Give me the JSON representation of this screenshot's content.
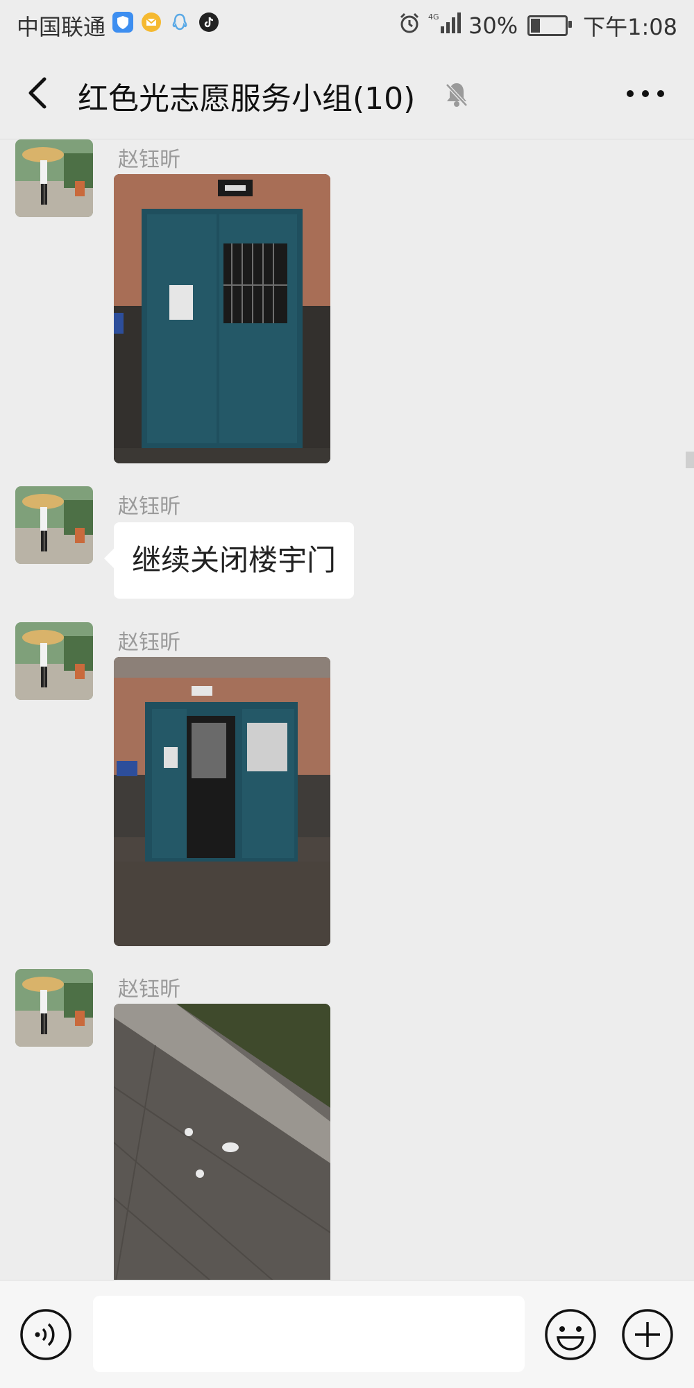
{
  "status_bar": {
    "carrier": "中国联通",
    "battery": "30%",
    "battery_level": 0.3,
    "time": "下午1:08",
    "network": "4G",
    "app_icons": [
      "shield-app-icon",
      "mail-app-icon",
      "qq-app-icon",
      "tiktok-app-icon"
    ]
  },
  "header": {
    "title": "红色光志愿服务小组(10)",
    "icons": [
      "back-arrow-icon",
      "mute-bell-icon",
      "more-dots-icon"
    ]
  },
  "messages": [
    {
      "sender": "赵钰昕",
      "type": "image",
      "image": "closed-blue-building-door"
    },
    {
      "sender": "赵钰昕",
      "type": "text",
      "text": "继续关闭楼宇门"
    },
    {
      "sender": "赵钰昕",
      "type": "image",
      "image": "open-blue-building-door"
    },
    {
      "sender": "赵钰昕",
      "type": "image",
      "image": "pavement-at-night"
    }
  ],
  "input_bar": {
    "message_value": "",
    "icons": [
      "voice-icon",
      "emoji-icon",
      "plus-icon"
    ]
  },
  "colors": {
    "background": "#ededed",
    "bubble": "#ffffff",
    "sender_text": "#9a9a9a",
    "door_blue": "#1f4f5e"
  }
}
